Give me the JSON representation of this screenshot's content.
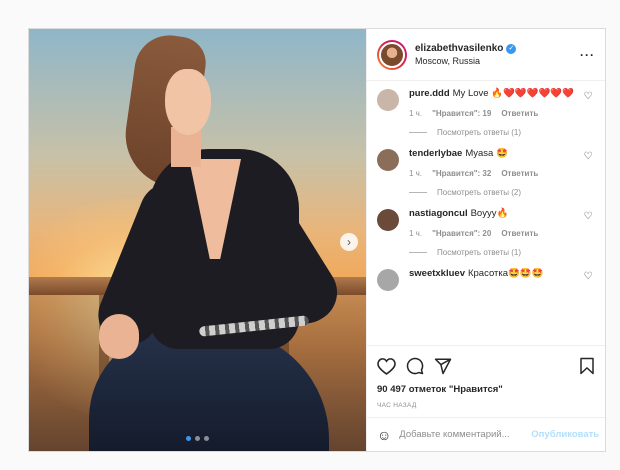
{
  "post": {
    "username": "elizabethvasilenko",
    "location": "Moscow, Russia",
    "more_icon": "more-horizontal-icon",
    "verified_icon": "verified-badge-icon",
    "carousel": {
      "slides": 3,
      "active": 0,
      "next_icon": "chevron-right-icon"
    }
  },
  "comments": [
    {
      "user": "pure.ddd",
      "text": "My Love 🔥❤️❤️❤️❤️❤️❤️",
      "time": "1 ч.",
      "likes": "\"Нравится\": 19",
      "reply": "Ответить",
      "view_replies": "Посмотреть ответы (1)",
      "avatar_color": "#c9b6a8"
    },
    {
      "user": "tenderlybae",
      "text": "Myasa 🤩",
      "time": "1 ч.",
      "likes": "\"Нравится\": 32",
      "reply": "Ответить",
      "view_replies": "Посмотреть ответы (2)",
      "avatar_color": "#8a6e5a"
    },
    {
      "user": "nastiagoncul",
      "text": "Boyyy🔥",
      "time": "1 ч.",
      "likes": "\"Нравится\": 20",
      "reply": "Ответить",
      "view_replies": "Посмотреть ответы (1)",
      "avatar_color": "#6b4a3a"
    },
    {
      "user": "sweetxkluev",
      "text": "Красотка🤩🤩🤩",
      "avatar_color": "#a7a7a7"
    }
  ],
  "actions": {
    "like_icon": "heart-outline-icon",
    "comment_icon": "comment-bubble-icon",
    "share_icon": "paper-plane-icon",
    "save_icon": "bookmark-icon",
    "likes_text": "90 497 отметок \"Нравится\"",
    "time_text": "ЧАС НАЗАД"
  },
  "add_comment": {
    "emoji_icon": "emoji-smile-icon",
    "placeholder": "Добавьте комментарий...",
    "post_label": "Опубликовать"
  },
  "colors": {
    "accent": "#3897f0",
    "post_disabled": "#b2dffc",
    "muted": "#8e8e8e",
    "text": "#262626"
  }
}
